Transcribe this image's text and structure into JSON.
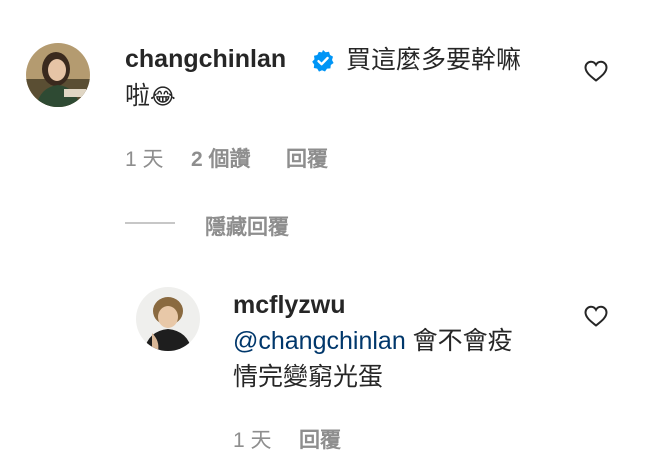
{
  "comment": {
    "username": "changchinlan",
    "text_line1": "買這麼多要幹嘛",
    "text_line2": "啦",
    "emoji": "😂",
    "time": "1 天",
    "likes": "2 個讚",
    "reply": "回覆"
  },
  "hide_replies": "隱藏回覆",
  "reply_comment": {
    "username": "mcflyzwu",
    "mention": "@changchinlan",
    "text_line1_rest": " 會不會疫",
    "text_line2": "情完變窮光蛋",
    "time": "1 天",
    "reply": "回覆"
  },
  "colors": {
    "text": "#262626",
    "secondary": "#8e8e8e",
    "mention": "#00376b",
    "verified": "#0095f6"
  },
  "icons": [
    "verified-badge-icon",
    "heart-icon"
  ]
}
